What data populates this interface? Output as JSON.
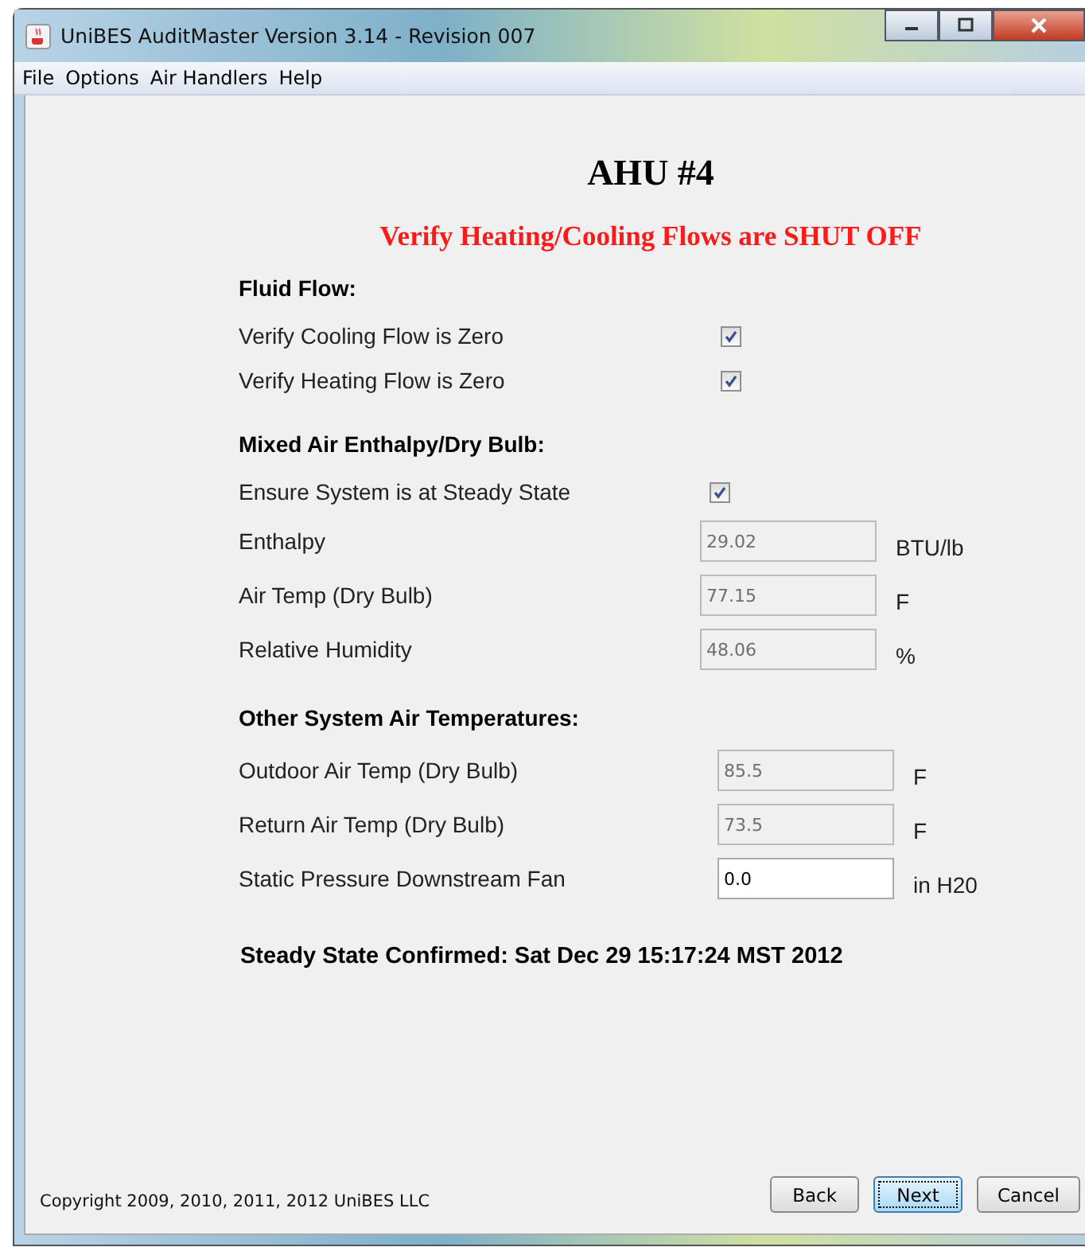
{
  "window": {
    "title": "UniBES AuditMaster Version 3.14 - Revision 007"
  },
  "menu": [
    "File",
    "Options",
    "Air Handlers",
    "Help"
  ],
  "heading": "AHU #4",
  "warning": "Verify Heating/Cooling Flows are SHUT OFF",
  "sections": [
    {
      "title": "Fluid Flow:",
      "rows": [
        {
          "kind": "check",
          "label": "Verify Cooling Flow is Zero",
          "checked": true
        },
        {
          "kind": "check",
          "label": "Verify Heating Flow is Zero",
          "checked": true
        }
      ]
    },
    {
      "title": "Mixed Air Enthalpy/Dry Bulb:",
      "rows": [
        {
          "kind": "check",
          "label": "Ensure System is at Steady State",
          "checked": true
        },
        {
          "kind": "field",
          "label": "Enthalpy",
          "value": "29.02",
          "unit": "BTU/lb",
          "disabled": true
        },
        {
          "kind": "field",
          "label": "Air Temp (Dry Bulb)",
          "value": "77.15",
          "unit": "F",
          "disabled": true
        },
        {
          "kind": "field",
          "label": "Relative Humidity",
          "value": "48.06",
          "unit": "%",
          "disabled": true
        }
      ]
    },
    {
      "title": "Other System Air Temperatures:",
      "rows": [
        {
          "kind": "field",
          "label": "Outdoor Air Temp (Dry Bulb)",
          "value": "85.5",
          "unit": "F",
          "disabled": true
        },
        {
          "kind": "field",
          "label": "Return Air Temp (Dry Bulb)",
          "value": "73.5",
          "unit": "F",
          "disabled": true
        },
        {
          "kind": "field",
          "label": "Static Pressure Downstream Fan",
          "value": "0.0",
          "unit": "in H20",
          "disabled": false
        }
      ]
    }
  ],
  "confirmation": "Steady State Confirmed: Sat Dec 29 15:17:24 MST 2012",
  "copyright": "Copyright 2009, 2010, 2011, 2012 UniBES LLC",
  "buttons": [
    {
      "label": "Back",
      "selected": false
    },
    {
      "label": "Next",
      "selected": true
    },
    {
      "label": "Cancel",
      "selected": false
    }
  ]
}
